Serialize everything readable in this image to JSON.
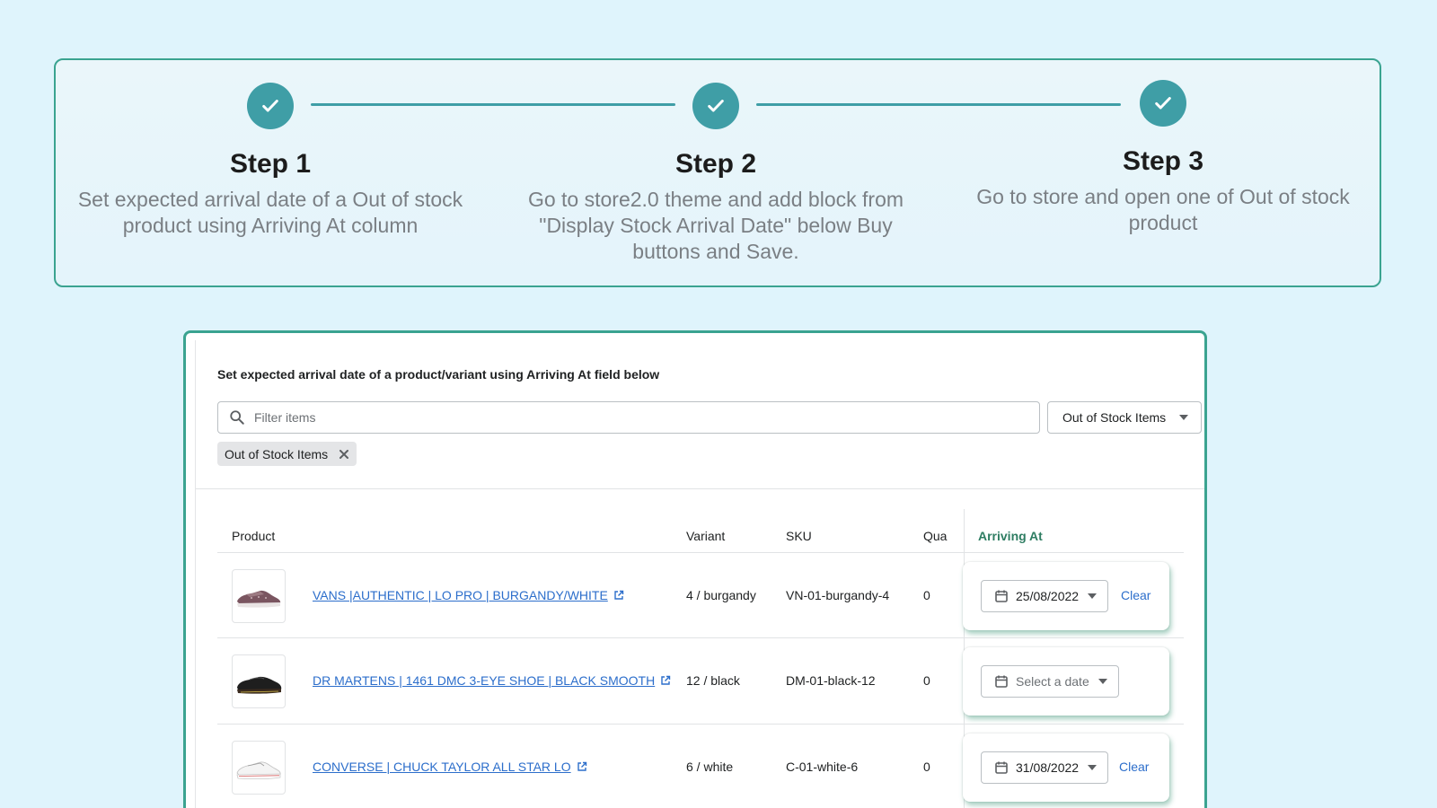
{
  "steps": [
    {
      "title": "Step 1",
      "description": "Set expected arrival date of a Out of stock product using Arriving At column"
    },
    {
      "title": "Step 2",
      "description": "Go to store2.0 theme and add block from \"Display Stock Arrival Date\" below Buy buttons and Save."
    },
    {
      "title": "Step 3",
      "description": "Go to store and open one of Out of stock product"
    }
  ],
  "app": {
    "instruction": "Set expected arrival date of a product/variant using Arriving At field below",
    "search": {
      "placeholder": "Filter items",
      "value": ""
    },
    "filter_select": {
      "selected": "Out of Stock Items"
    },
    "applied_filter_tag": "Out of Stock Items",
    "table": {
      "headers": {
        "product": "Product",
        "variant": "Variant",
        "sku": "SKU",
        "quantity": "Qua",
        "arriving_at": "Arriving At"
      },
      "rows": [
        {
          "product": "VANS |AUTHENTIC | LO PRO | BURGANDY/WHITE",
          "variant": "4 / burgandy",
          "sku": "VN-01-burgandy-4",
          "quantity": "0",
          "date": "25/08/2022",
          "clear": "Clear",
          "thumb": "burgundy-sneaker"
        },
        {
          "product": "DR MARTENS | 1461 DMC 3-EYE SHOE | BLACK SMOOTH",
          "variant": "12 / black",
          "sku": "DM-01-black-12",
          "quantity": "0",
          "date": "Select a date",
          "clear": "",
          "thumb": "black-shoe"
        },
        {
          "product": "CONVERSE | CHUCK TAYLOR ALL STAR LO",
          "variant": "6 / white",
          "sku": "C-01-white-6",
          "quantity": "0",
          "date": "31/08/2022",
          "clear": "Clear",
          "thumb": "white-sneaker"
        }
      ]
    }
  },
  "colors": {
    "page_bg": "#dff4fc",
    "accent_teal": "#3f9ea6",
    "frame_green": "#3aa390",
    "link_blue": "#2c6ecb",
    "arriving_header": "#2e7d62"
  },
  "icons": {
    "step_check": "checkmark-icon",
    "search": "search-icon",
    "tag_close": "close-icon",
    "external": "external-link-icon",
    "calendar": "calendar-icon",
    "caret": "caret-down-icon"
  }
}
